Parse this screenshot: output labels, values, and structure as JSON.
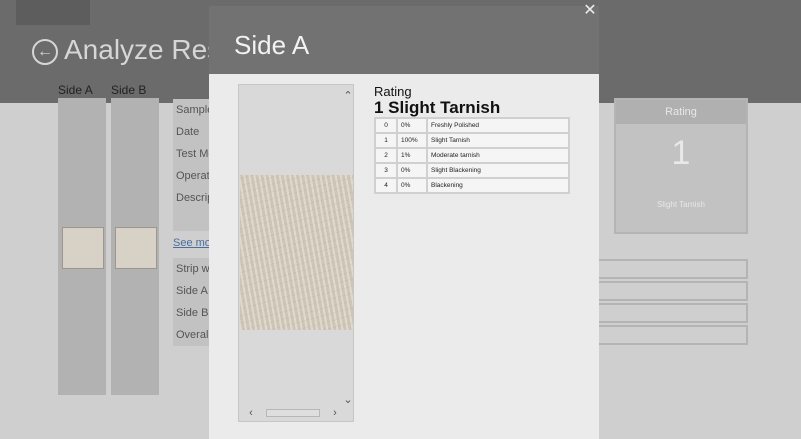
{
  "background": {
    "title": "Analyze Resu",
    "side_tabs": [
      "Side A",
      "Side B"
    ],
    "detail_rows": [
      "Sample",
      "Date",
      "Test Me",
      "Operat",
      "Descrip"
    ],
    "see_more": "See mor",
    "lower_rows": [
      "Strip wi",
      "Side A r",
      "Side B r",
      "Overall"
    ],
    "rating_panel": {
      "header": "Rating",
      "value": "1",
      "label": "Slight Tarnish"
    }
  },
  "dialog": {
    "title": "Side A",
    "close_icon": "close-icon",
    "rating_label": "Rating",
    "rating_value": "1 Slight Tarnish",
    "rating_table": [
      {
        "level": "0",
        "percent": "0%",
        "name": "Freshly Polished"
      },
      {
        "level": "1",
        "percent": "100%",
        "name": "Slight Tarnish"
      },
      {
        "level": "2",
        "percent": "1%",
        "name": "Moderate tarnish"
      },
      {
        "level": "3",
        "percent": "0%",
        "name": "Slight Blackening"
      },
      {
        "level": "4",
        "percent": "0%",
        "name": "Blackening"
      }
    ]
  }
}
